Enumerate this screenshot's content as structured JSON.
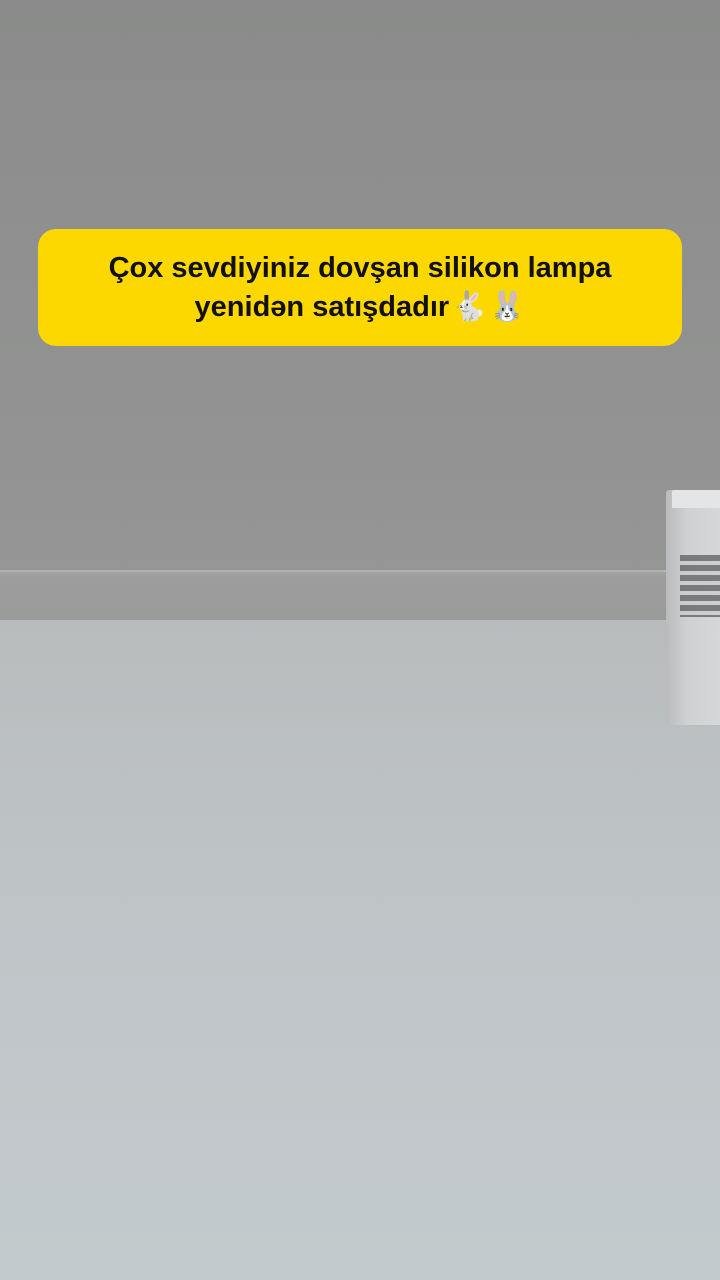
{
  "caption": {
    "line1": "Çox sevdiyiniz dovşan silikon lampa",
    "line2": "yenidən satışdadır",
    "emojis": [
      "🐇",
      "🐰"
    ],
    "background_color": "#fcd700",
    "text_color": "#111111"
  }
}
